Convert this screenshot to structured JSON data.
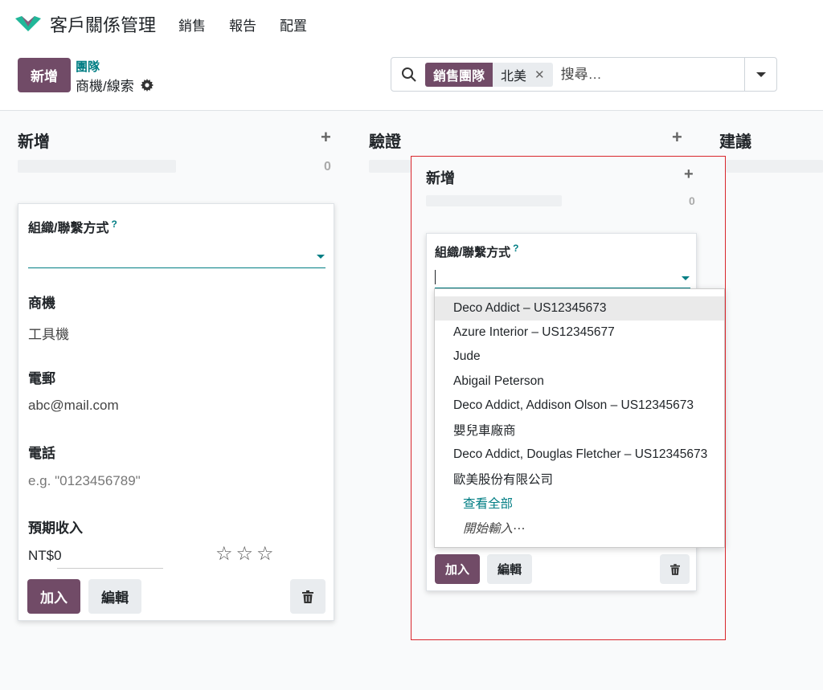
{
  "navbar": {
    "app_title": "客戶關係管理",
    "menu": [
      "銷售",
      "報告",
      "配置"
    ]
  },
  "control": {
    "new_button": "新增",
    "breadcrumb": "團隊",
    "subtitle": "商機/線索",
    "search": {
      "facet_label": "銷售團隊",
      "facet_value": "北美",
      "placeholder": "搜尋…"
    }
  },
  "columns": [
    {
      "title": "新增",
      "count": "0"
    },
    {
      "title": "驗證"
    },
    {
      "title": "建議"
    }
  ],
  "left_card": {
    "org_label": "組織/聯繫方式",
    "help_mark": "?",
    "opportunity_label": "商機",
    "opportunity_value": "工具機",
    "email_label": "電郵",
    "email_value": "abc@mail.com",
    "phone_label": "電話",
    "phone_placeholder": "e.g. \"0123456789\"",
    "revenue_label": "預期收入",
    "revenue_value": "NT$0",
    "priority_stars": 0,
    "add_button": "加入",
    "edit_button": "編輯"
  },
  "inner_column": {
    "title": "新增",
    "count": "0"
  },
  "right_card": {
    "org_label": "組織/聯繫方式",
    "help_mark": "?",
    "add_button": "加入",
    "edit_button": "編輯"
  },
  "dropdown": {
    "items": [
      "Deco Addict – US12345673",
      "Azure Interior – US12345677",
      "Jude",
      "Abigail Peterson",
      "Deco Addict, Addison Olson – US12345673",
      "嬰兒車廠商",
      "Deco Addict, Douglas Fletcher – US12345673",
      "歐美股份有限公司"
    ],
    "view_all": "查看全部",
    "start_typing": "開始輸入⋯"
  },
  "colors": {
    "primary": "#714b67",
    "accent": "#017e84",
    "highlight": "#d9262c"
  }
}
